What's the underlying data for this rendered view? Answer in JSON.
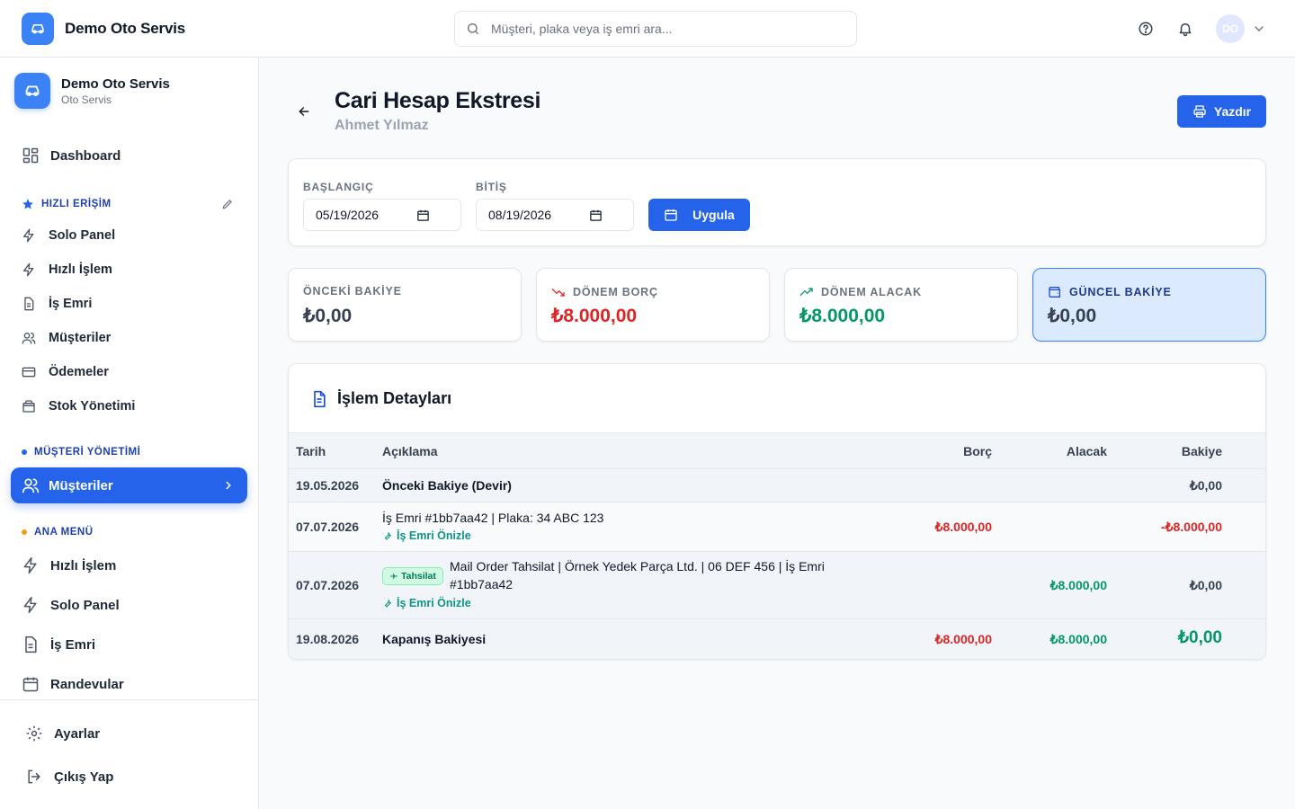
{
  "topbar": {
    "brand": "Demo Oto Servis",
    "search_placeholder": "Müşteri, plaka veya iş emri ara...",
    "avatar_initials": "DO"
  },
  "sidebar": {
    "title": "Demo Oto Servis",
    "subtitle": "Oto Servis",
    "dashboard": "Dashboard",
    "quick_section": "HIZLI ERİŞİM",
    "quick_items": [
      "Solo Panel",
      "Hızlı İşlem",
      "İş Emri",
      "Müşteriler",
      "Ödemeler",
      "Stok Yönetimi"
    ],
    "customer_section": "MÜŞTERİ YÖNETİMİ",
    "active_item": "Müşteriler",
    "main_section": "ANA MENÜ",
    "main_items": [
      "Hızlı İşlem",
      "Solo Panel",
      "İş Emri",
      "Randevular"
    ],
    "settings": "Ayarlar",
    "logout": "Çıkış Yap"
  },
  "page": {
    "title": "Cari Hesap Ekstresi",
    "subtitle": "Ahmet Yılmaz",
    "print_label": "Yazdır"
  },
  "filter": {
    "start_label": "BAŞLANGIÇ",
    "start_value": "05/19/2026",
    "end_label": "BİTİŞ",
    "end_value": "08/19/2026",
    "apply_label": "Uygula"
  },
  "stats": [
    {
      "label": "ÖNCEKİ BAKİYE",
      "value": "₺0,00",
      "color": "#374151"
    },
    {
      "label": "DÖNEM BORÇ",
      "value": "₺8.000,00",
      "color": "#dc2626"
    },
    {
      "label": "DÖNEM ALACAK",
      "value": "₺8.000,00",
      "color": "#059669"
    },
    {
      "label": "GÜNCEL BAKİYE",
      "value": "₺0,00",
      "color": "#374151"
    }
  ],
  "table": {
    "title": "İşlem Detayları",
    "headers": {
      "date": "Tarih",
      "desc": "Açıklama",
      "debt": "Borç",
      "credit": "Alacak",
      "balance": "Bakiye"
    },
    "rows": [
      {
        "date": "19.05.2026",
        "desc": "Önceki Bakiye (Devir)",
        "debt": "",
        "credit": "",
        "balance": "₺0,00"
      },
      {
        "date": "07.07.2026",
        "desc": "İş Emri #1bb7aa42 | Plaka: 34 ABC 123",
        "link": "İş Emri Önizle",
        "debt": "₺8.000,00",
        "credit": "",
        "balance": "-₺8.000,00"
      },
      {
        "date": "07.07.2026",
        "badge": "Tahsilat",
        "desc_line1": "Mail Order Tahsilat | Örnek Yedek Parça Ltd. | 06 DEF 456 | İş Emri",
        "desc_line2": "#1bb7aa42",
        "link": "İş Emri Önizle",
        "debt": "",
        "credit": "₺8.000,00",
        "balance": "₺0,00"
      }
    ],
    "footer": {
      "date": "19.08.2026",
      "desc": "Kapanış Bakiyesi",
      "debt": "₺8.000,00",
      "credit": "₺8.000,00",
      "balance": "₺0,00"
    }
  },
  "colors": {
    "accent": "#2563eb",
    "debt": "#dc2626",
    "credit": "#059669",
    "brand_icon": "#3b82f6"
  }
}
